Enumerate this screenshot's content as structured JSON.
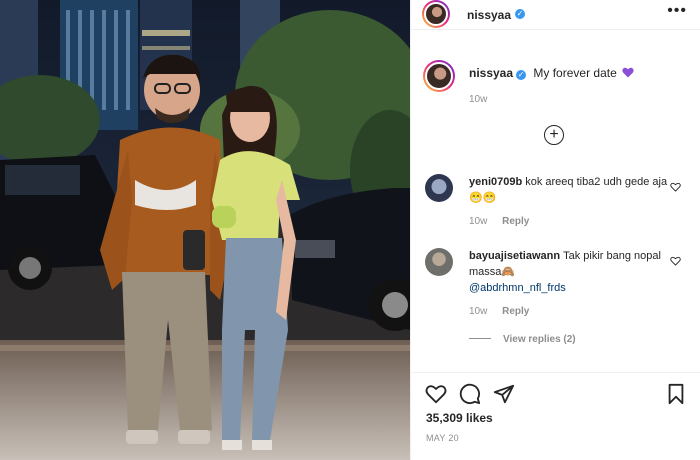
{
  "post": {
    "photo_alt": "Photo by nissyaa"
  },
  "header": {
    "username": "nissyaa",
    "verified_mark": "✓",
    "more_label": "•••"
  },
  "caption": {
    "username": "nissyaa",
    "text": "My forever date",
    "emoji": "purple-heart",
    "time": "10w"
  },
  "load_more_label": "+",
  "comments": [
    {
      "username": "yeni0709b",
      "text": "kok areeq tiba2 udh gede aja😁😁",
      "time": "10w",
      "reply_label": "Reply"
    },
    {
      "username": "bayuajisetiawann",
      "text": "Tak pikir bang nopal massa🙈",
      "mention": "@abdrhmn_nfl_frds",
      "time": "10w",
      "reply_label": "Reply"
    }
  ],
  "view_replies_label": "View replies (2)",
  "actions": {
    "like_icon": "heart-icon",
    "comment_icon": "comment-icon",
    "share_icon": "paper-plane-icon",
    "save_icon": "bookmark-icon"
  },
  "likes_text": "35,309 likes",
  "date": "MAY 20",
  "colors": {
    "accent": "#3897f0",
    "muted": "#8e8e8e",
    "text": "#262626",
    "mention": "#00376b",
    "heart_emoji": "#8b4fd8"
  }
}
